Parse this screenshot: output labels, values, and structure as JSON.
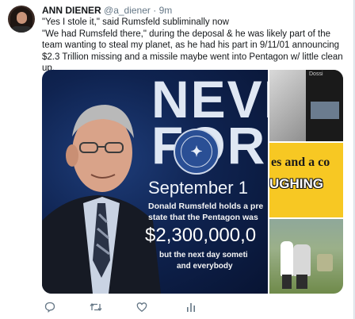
{
  "tweet": {
    "author_name": "ANN DIENER",
    "handle": "@a_diener",
    "separator": "·",
    "time": "9m",
    "lines": [
      "\"Yes I stole it,\" said Rumsfeld subliminally now",
      "\"We had Rumsfeld there,\" during the deposal & he was likely part of the team wanting to steal my planet, as he had his part in 9/11/01 announcing $2.3 Trillion missing and a missile maybe went into Pentagon w/ little clean up."
    ]
  },
  "media": {
    "main": {
      "headline_1": "NEVE",
      "headline_2": "FORG",
      "date": "September 1",
      "caption_1": "Donald Rumsfeld holds a pre",
      "caption_2": "state that the Pentagon was",
      "amount": "$2,300,000,0",
      "caption_3": "but the next day someti",
      "caption_4": "and everybody"
    },
    "thumb1_title": "Dossi",
    "thumb2_line1": "es and a co",
    "thumb2_line2": "UGHING"
  },
  "actions": [
    "reply-icon",
    "retweet-icon",
    "like-icon",
    "analytics-icon"
  ],
  "colors": {
    "icon_gray": "#657786",
    "text": "#14171a",
    "poster_blue": "#0f2350"
  }
}
